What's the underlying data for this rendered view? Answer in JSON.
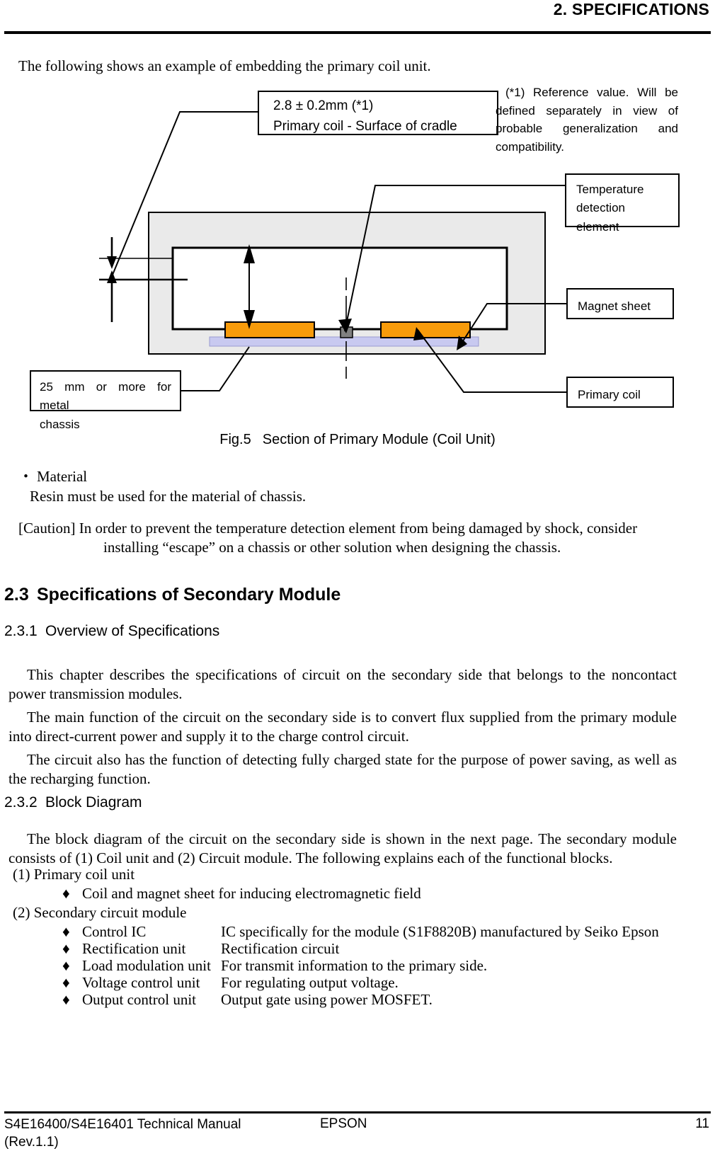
{
  "header": {
    "title": "2. SPECIFICATIONS"
  },
  "intro": "The following shows an example of embedding the primary coil unit.",
  "figure": {
    "callout_dimension": {
      "line1": "2.8 ± 0.2mm (*1)",
      "line2": "Primary coil - Surface of cradle"
    },
    "note": "(*1) Reference value. Will be defined separately in view of probable generalization and compatibility.",
    "label_temperature": "Temperature\ndetection element",
    "label_temperature_l1": "Temperature",
    "label_temperature_l2": "detection element",
    "label_magnet": "Magnet sheet",
    "label_primary_coil": "Primary coil",
    "label_chassis_l1": "25 mm or more for metal",
    "label_chassis_l2": "chassis",
    "colors": {
      "coil": "#F79B0B",
      "magnet_sheet": "#C8C9F0",
      "chassis": "#EAEAEA",
      "temp_element": "#808080",
      "outline": "#000000"
    },
    "caption_number": "Fig.5",
    "caption_text": "Section of Primary Module (Coil Unit)"
  },
  "material": {
    "bullet": "・",
    "heading": "Material",
    "text": "Resin must be used for the material of chassis."
  },
  "caution": {
    "label": "[Caution]",
    "line1": "In order to prevent the temperature detection element from being damaged by shock, consider",
    "line2": "installing “escape” on a chassis or other solution when designing the chassis."
  },
  "section_2_3": {
    "number": "2.3",
    "title": "Specifications of Secondary Module"
  },
  "section_2_3_1": {
    "number": "2.3.1",
    "title": "Overview of Specifications",
    "para1": "This chapter describes the specifications of circuit on the secondary side that belongs to the noncontact power transmission modules.",
    "para2": "The main function of the circuit on the secondary side is to convert flux supplied from the primary module into direct-current power and supply it to the charge control circuit.",
    "para3": "The circuit also has the function of detecting fully charged state for the purpose of power saving, as well as the recharging function."
  },
  "section_2_3_2": {
    "number": "2.3.2",
    "title": "Block Diagram",
    "para1": "The block diagram of the circuit on the secondary side is shown in the next page. The secondary module consists of (1) Coil unit and (2) Circuit module. The following explains each of the functional blocks.",
    "group1": "(1) Primary coil unit",
    "group2": "(2) Secondary circuit module",
    "bullet_glyph": "♦",
    "items": [
      {
        "term": "Coil and magnet sheet for inducing electromagnetic field",
        "desc": ""
      },
      {
        "term": "Control IC",
        "desc": "IC specifically for the module (S1F8820B) manufactured by Seiko Epson"
      },
      {
        "term": "Rectification unit",
        "desc": "Rectification circuit"
      },
      {
        "term": "Load modulation unit",
        "desc": "For transmit information to the primary side."
      },
      {
        "term": "Voltage control unit",
        "desc": "For regulating output voltage."
      },
      {
        "term": "Output control unit",
        "desc": "Output gate using power MOSFET."
      }
    ]
  },
  "footer": {
    "left_line1": "S4E16400/S4E16401 Technical Manual",
    "left_line2": "(Rev.1.1)",
    "center": "EPSON",
    "page": "11"
  }
}
